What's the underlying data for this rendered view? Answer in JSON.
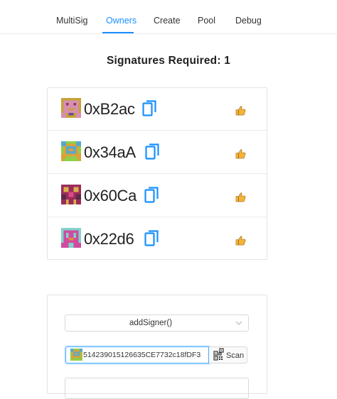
{
  "nav": {
    "tabs": [
      {
        "label": "MultiSig"
      },
      {
        "label": "Owners"
      },
      {
        "label": "Create"
      },
      {
        "label": "Pool"
      },
      {
        "label": "Debug"
      }
    ],
    "active_tab": "Owners",
    "accent_color": "#1890ff"
  },
  "signatures": {
    "title": "Signatures Required: 1"
  },
  "owners": [
    {
      "address": "0xB2ac",
      "icons": [
        "blockie-avatar",
        "copy-icon",
        "thumbs-up-icon"
      ]
    },
    {
      "address": "0x34aA",
      "icons": [
        "blockie-avatar",
        "copy-icon",
        "thumbs-up-icon"
      ]
    },
    {
      "address": "0x60Ca",
      "icons": [
        "blockie-avatar",
        "copy-icon",
        "thumbs-up-icon"
      ]
    },
    {
      "address": "0x22d6",
      "icons": [
        "blockie-avatar",
        "copy-icon",
        "thumbs-up-icon"
      ]
    }
  ],
  "form": {
    "method_select": {
      "selected": "addSigner()"
    },
    "address_input": {
      "value": "514239015126635CE7732c18fDF3"
    },
    "scan_button": {
      "label": "Scan",
      "icon": "qr-scan-icon"
    }
  },
  "colors": {
    "copy_icon": "#1890ff",
    "thumbs_up": "#f5b33a"
  }
}
